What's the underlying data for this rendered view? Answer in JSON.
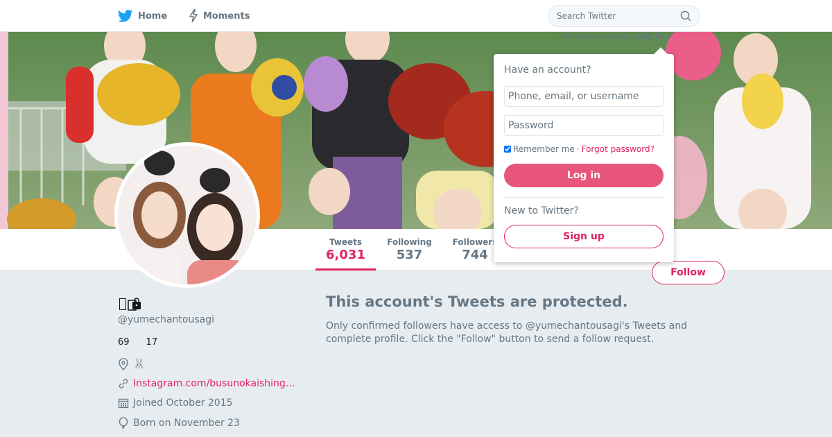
{
  "nav": {
    "home_label": "Home",
    "moments_label": "Moments"
  },
  "search": {
    "placeholder": "Search Twitter"
  },
  "header": {
    "have_account_text": "Have an account?",
    "login_link": "Log in"
  },
  "profile": {
    "display_name": "",
    "handle": "@yumechantousagi",
    "count_a": "69",
    "count_b": "17",
    "location": "🐰",
    "website": "Instagram.com/busunokaishing…",
    "joined": "Joined October 2015",
    "born": "Born on November 23"
  },
  "stats": [
    {
      "label": "Tweets",
      "value": "6,031"
    },
    {
      "label": "Following",
      "value": "537"
    },
    {
      "label": "Followers",
      "value": "744"
    }
  ],
  "follow_button": "Follow",
  "protected": {
    "title": "This account's Tweets are protected.",
    "description": "Only confirmed followers have access to @yumechantousagi's Tweets and complete profile. Click the \"Follow\" button to send a follow request."
  },
  "login_dropdown": {
    "title": "Have an account?",
    "username_placeholder": "Phone, email, or username",
    "password_placeholder": "Password",
    "remember_label": "Remember me",
    "separator": "·",
    "forgot_label": "Forgot password?",
    "login_button": "Log in",
    "new_label": "New to Twitter?",
    "signup_button": "Sign up"
  },
  "colors": {
    "accent": "#e0245e",
    "twitter_blue": "#1da1f2",
    "login_button": "#e8557a",
    "muted_text": "#657786",
    "page_bg": "#e6ecf0"
  },
  "icons": [
    "twitter-bird-icon",
    "moments-icon",
    "search-icon",
    "lock-icon",
    "location-icon",
    "link-icon",
    "calendar-icon",
    "balloon-icon",
    "caret-down-icon"
  ]
}
